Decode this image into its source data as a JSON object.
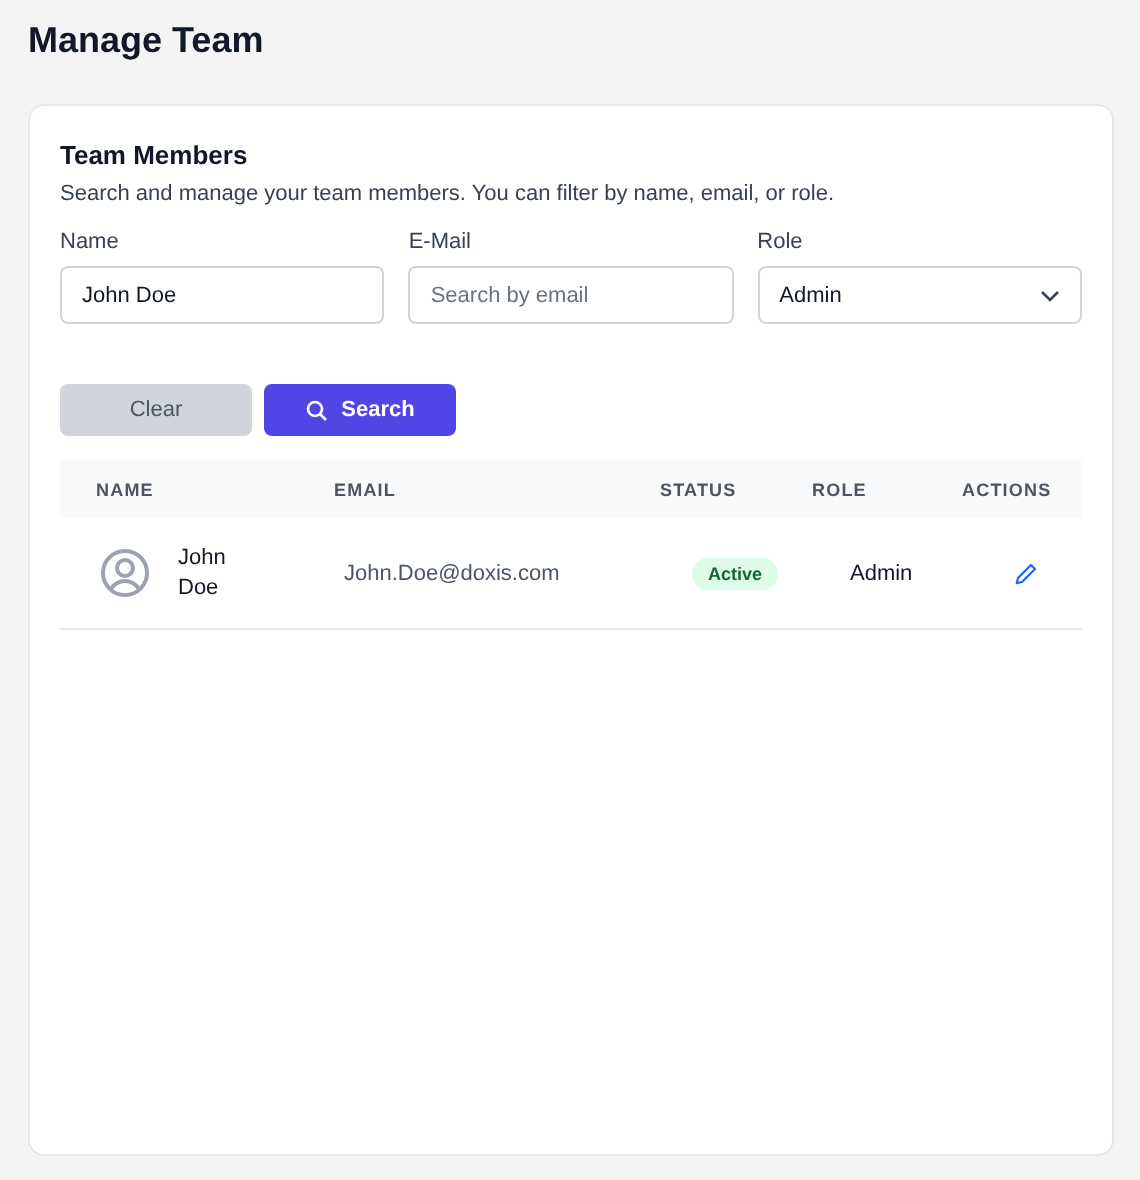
{
  "page_title": "Manage Team",
  "card": {
    "title": "Team Members",
    "description": "Search and manage your team members. You can filter by name, email, or role."
  },
  "filters": [
    {
      "kind": "text",
      "label": "Name",
      "value": "John Doe"
    },
    {
      "kind": "text",
      "label": "E-Mail",
      "placeholder": "Search by email"
    },
    {
      "kind": "select",
      "label": "Role",
      "value": "Admin"
    }
  ],
  "buttons": [
    {
      "kind": "secondary",
      "label": "Clear"
    },
    {
      "kind": "primary",
      "label": "Search"
    }
  ],
  "table": {
    "columns": [
      "NAME",
      "EMAIL",
      "STATUS",
      "ROLE",
      "ACTIONS"
    ],
    "rows": [
      {
        "name": "John Doe",
        "email": "John.Doe@doxis.com",
        "status": "Active",
        "role": "Admin"
      }
    ]
  }
}
